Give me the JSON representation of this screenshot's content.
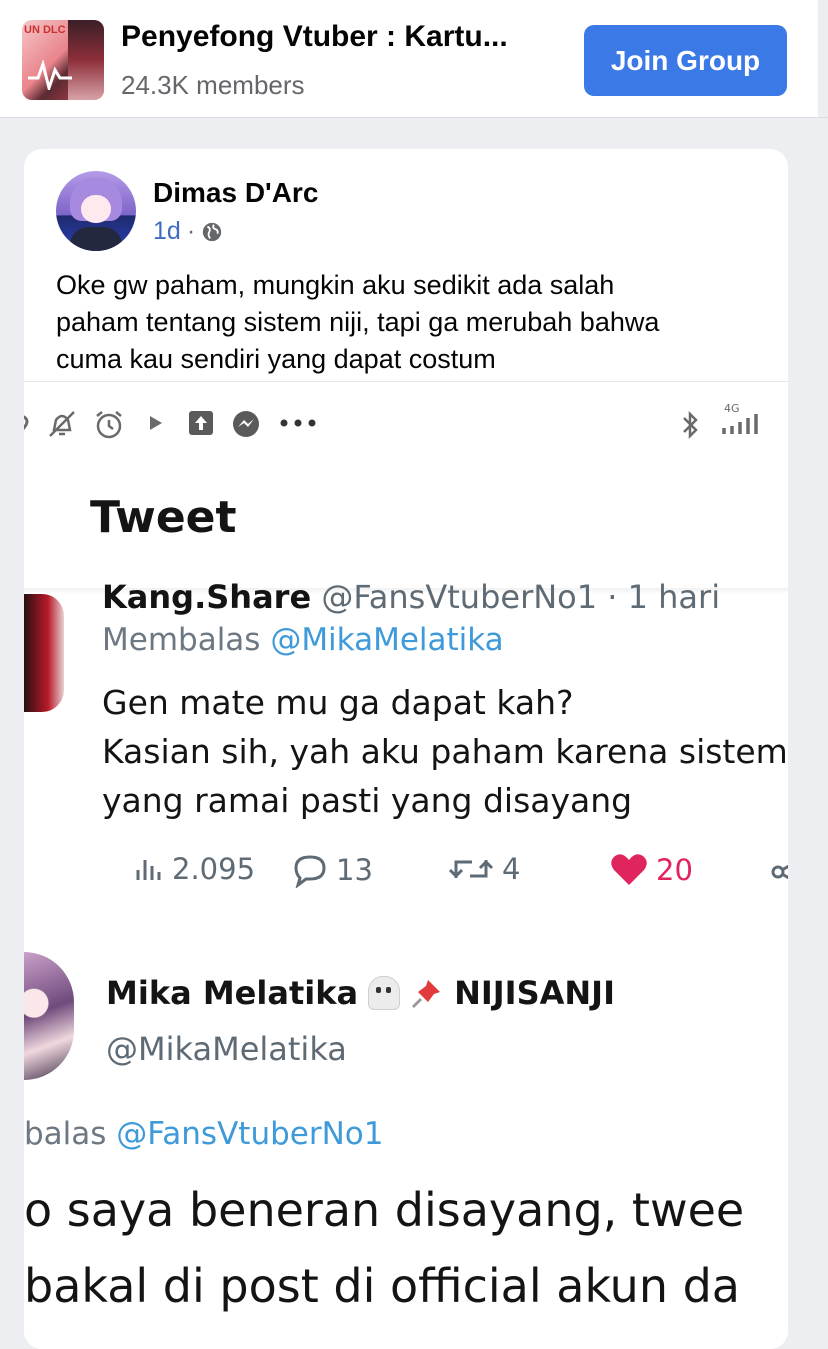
{
  "group": {
    "title": "Penyefong Vtuber : Kartu...",
    "members": "24.3K members",
    "join_label": "Join Group",
    "thumb_text": "UN DLC"
  },
  "post": {
    "author": "Dimas D'Arc",
    "time": "1d",
    "separator": "·",
    "text_lines": [
      "Oke gw paham, mungkin aku sedikit ada salah",
      "paham tentang sistem niji, tapi ga merubah bahwa",
      "cuma kau sendiri yang dapat costum"
    ]
  },
  "screenshot": {
    "title": "Tweet",
    "network": "4G",
    "tweet1": {
      "name": "Kang.Share",
      "handle_time": "@FansVtuberNo1 · 1 hari",
      "reply_prefix": "Membalas",
      "reply_mention": "@MikaMelatika",
      "body_lines": [
        "Gen mate mu ga dapat kah?",
        "Kasian sih, yah aku paham karena sistem",
        "yang ramai pasti yang disayang"
      ],
      "views": "2.095",
      "replies": "13",
      "retweets": "4",
      "likes": "20"
    },
    "tweet2": {
      "name": "Mika Melatika",
      "org": "NIJISANJI",
      "handle": "@MikaMelatika",
      "reply_prefix": "balas",
      "reply_mention": "@FansVtuberNo1",
      "body_lines": [
        "o saya beneran disayang, twee",
        "bakal di post di official akun da"
      ]
    }
  },
  "colors": {
    "join_button": "#3b7ae6",
    "mention": "#3e9ad9",
    "like": "#e0245e",
    "meta": "#3f6cc4"
  }
}
